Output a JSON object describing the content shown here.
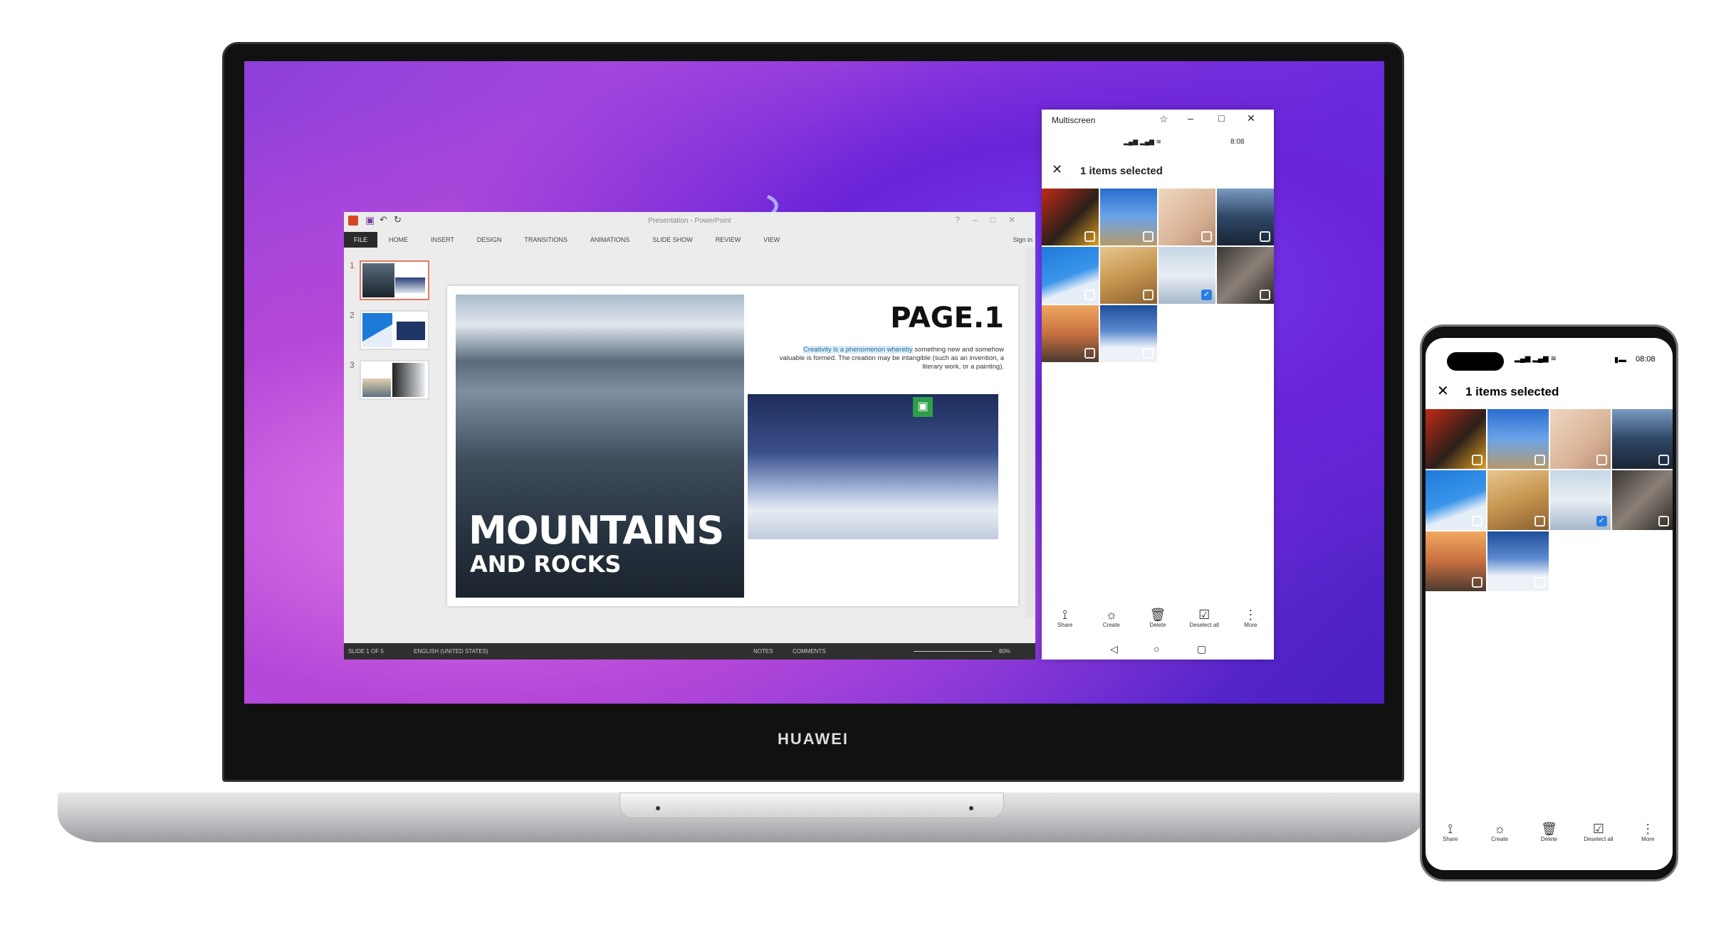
{
  "brand": "HUAWEI",
  "powerpoint": {
    "title": "Presentation - PowerPoint",
    "sign_in": "Sign in",
    "tabs": [
      "FILE",
      "HOME",
      "INSERT",
      "DESIGN",
      "TRANSITIONS",
      "ANIMATIONS",
      "SLIDE SHOW",
      "REVIEW",
      "VIEW"
    ],
    "thumbnails": [
      "1",
      "2",
      "3"
    ],
    "slide": {
      "title_big": "MOUNTAINS",
      "title_small": "AND ROCKS",
      "page_label": "PAGE.1",
      "body_highlight": "Creativity is a phenomenon whereby",
      "body_rest": " something new and somehow valuable is formed. The creation may be intangible (such as an invention, a literary work, or a painting)."
    },
    "status": {
      "slide": "SLIDE 1 OF 5",
      "language": "ENGLISH (UNITED STATES)",
      "notes": "NOTES",
      "comments": "COMMENTS",
      "zoom": "80%"
    }
  },
  "multiscreen": {
    "title": "Multiscreen",
    "status_time": "8:08",
    "header": "1 items selected",
    "photos": [
      {
        "selected": false
      },
      {
        "selected": false
      },
      {
        "selected": false
      },
      {
        "selected": false
      },
      {
        "selected": false
      },
      {
        "selected": false
      },
      {
        "selected": true
      },
      {
        "selected": false
      },
      {
        "selected": false
      },
      {
        "selected": false
      }
    ],
    "actions": [
      {
        "icon": "share-icon",
        "label": "Share"
      },
      {
        "icon": "create-icon",
        "label": "Create"
      },
      {
        "icon": "delete-icon",
        "label": "Delete"
      },
      {
        "icon": "deselect-all-icon",
        "label": "Deselect all"
      },
      {
        "icon": "more-icon",
        "label": "More"
      }
    ]
  },
  "phone": {
    "status_time": "08:08",
    "header": "1 items selected",
    "actions": [
      {
        "label": "Share"
      },
      {
        "label": "Create"
      },
      {
        "label": "Delete"
      },
      {
        "label": "Deselect all"
      },
      {
        "label": "More"
      }
    ]
  },
  "colors": {
    "accent": "#2a7de1",
    "ppt_file_tab": "#2b2b2b",
    "selection_border": "#e8795c"
  }
}
